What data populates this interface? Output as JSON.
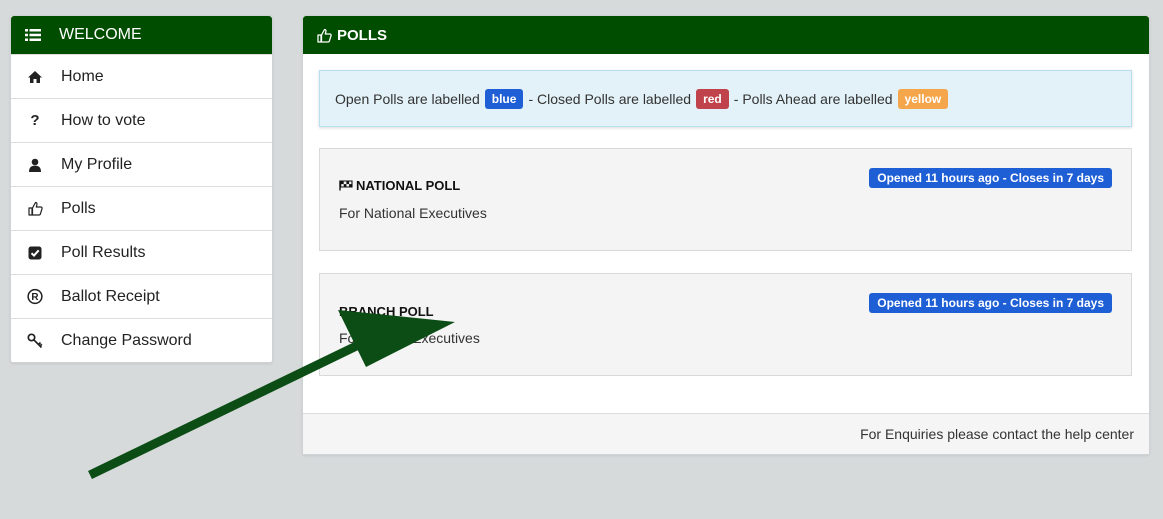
{
  "sidebar": {
    "title": "WELCOME",
    "items": [
      {
        "label": "Home",
        "icon": "home-icon"
      },
      {
        "label": "How to vote",
        "icon": "question-icon"
      },
      {
        "label": "My Profile",
        "icon": "user-icon"
      },
      {
        "label": "Polls",
        "icon": "thumbs-up-icon"
      },
      {
        "label": "Poll Results",
        "icon": "check-square-icon"
      },
      {
        "label": "Ballot Receipt",
        "icon": "registered-icon"
      },
      {
        "label": "Change Password",
        "icon": "key-icon"
      }
    ]
  },
  "panel": {
    "title": "POLLS",
    "legend": {
      "text1": "Open Polls are labelled",
      "blue": "blue",
      "text2": "- Closed Polls are labelled",
      "red": "red",
      "text3": "- Polls Ahead are labelled",
      "yellow": "yellow"
    },
    "polls": [
      {
        "title": "NATIONAL POLL",
        "description": "For National Executives",
        "status": "Opened 11 hours ago - Closes in 7 days"
      },
      {
        "title": "BRANCH POLL",
        "description": "For Branch Executives",
        "status": "Opened 11 hours ago - Closes in 7 days"
      }
    ],
    "footer": "For Enquiries please contact the help center"
  },
  "colors": {
    "header": "#004d00",
    "blue_tag": "#1f5fd6",
    "red_tag": "#c0434b",
    "yellow_tag": "#f5a54a",
    "arrow": "#0b4d14"
  }
}
